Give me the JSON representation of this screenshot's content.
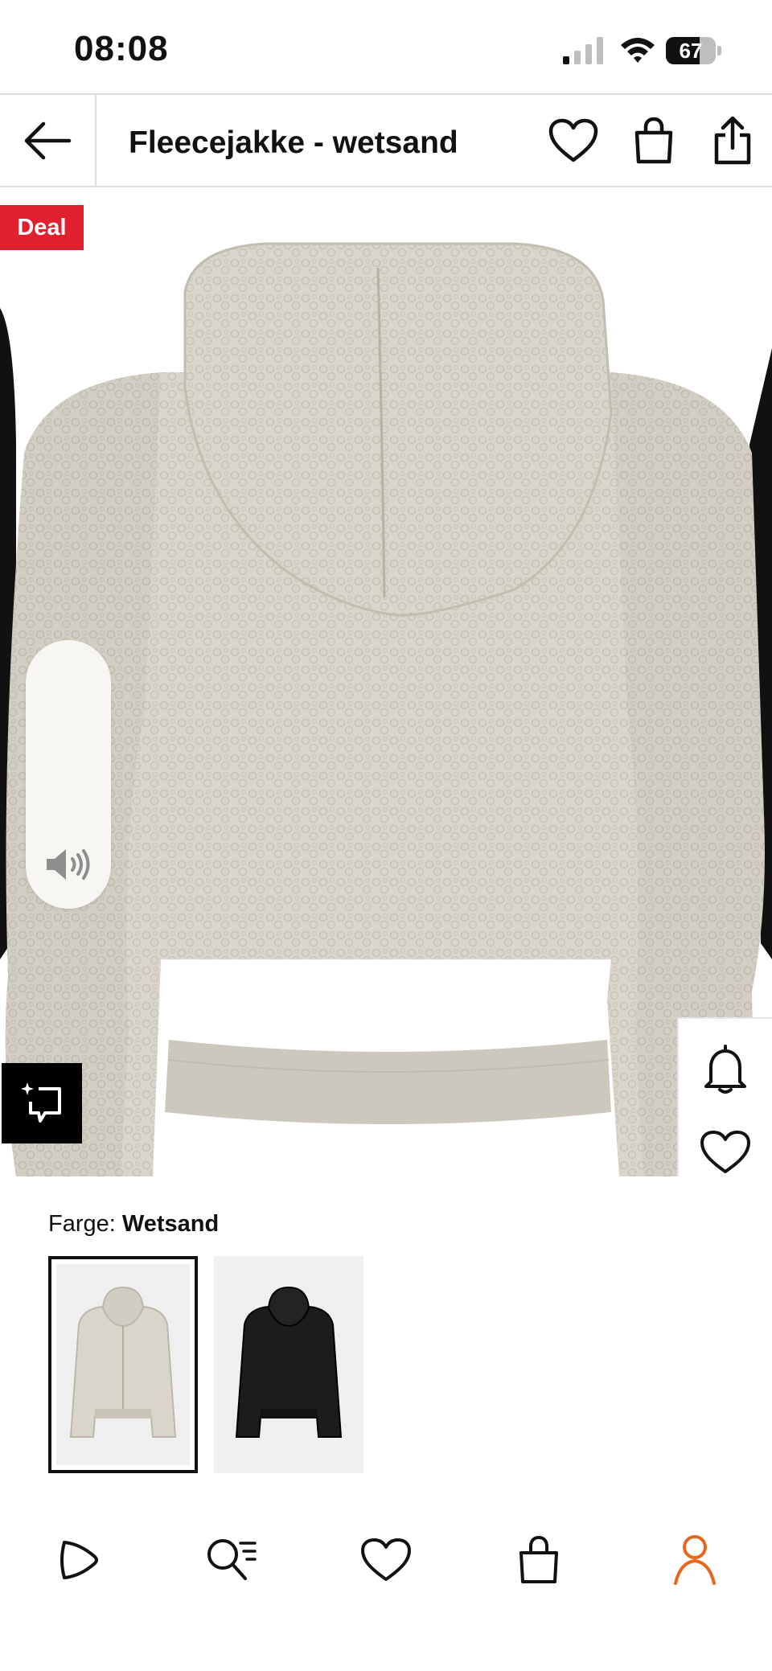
{
  "status_bar": {
    "time": "08:08",
    "battery_percent": "67",
    "battery_level": 0.67,
    "signal_bars_active": 1,
    "icons": [
      "signal-icon",
      "wifi-icon",
      "battery-icon"
    ]
  },
  "header": {
    "title": "Fleecejakke - wetsand",
    "icons": [
      "back-arrow-icon",
      "heart-icon",
      "shopping-bag-icon",
      "share-icon"
    ]
  },
  "product": {
    "badge": "Deal",
    "icons": [
      "volume-icon",
      "ai-search-icon",
      "bell-icon",
      "heart-icon"
    ]
  },
  "color_selector": {
    "label": "Farge:",
    "selected_value": "Wetsand",
    "swatches": [
      {
        "name": "Wetsand",
        "selected": true,
        "color": "#d9d5cb"
      },
      {
        "name": "Black",
        "selected": false,
        "color": "#1c1c1e"
      }
    ]
  },
  "bottom_nav": {
    "items": [
      {
        "icon": "play-icon",
        "active": false
      },
      {
        "icon": "search-icon",
        "active": false
      },
      {
        "icon": "heart-icon",
        "active": false
      },
      {
        "icon": "shopping-bag-icon",
        "active": false
      },
      {
        "icon": "profile-icon",
        "active": true
      }
    ],
    "active_color": "#e8671f"
  },
  "colors": {
    "deal": "#e0202e",
    "fleece": "#d9d5cb",
    "text": "#111111"
  }
}
